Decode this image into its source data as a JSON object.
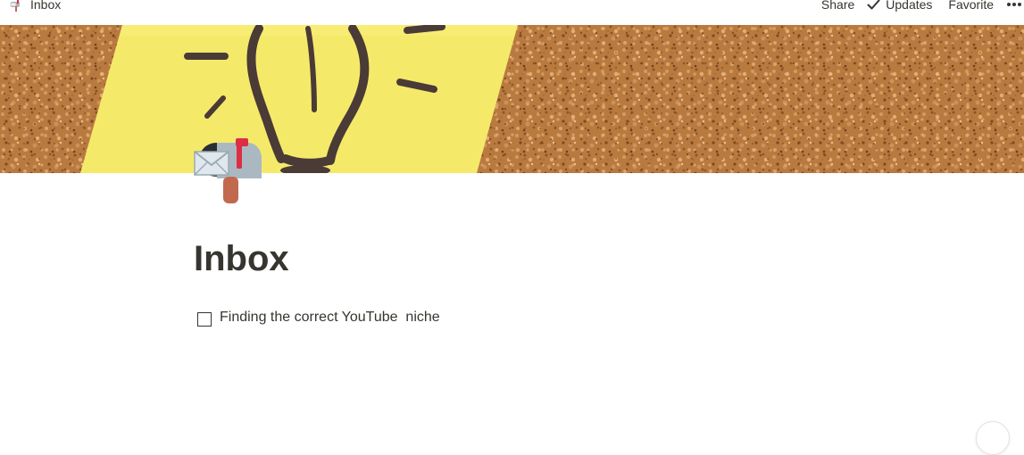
{
  "topbar": {
    "breadcrumb_title": "Inbox",
    "breadcrumb_icon": "mailbox-icon",
    "share_label": "Share",
    "updates_label": "Updates",
    "favorite_label": "Favorite",
    "more_icon": "more-horizontal-icon"
  },
  "cover": {
    "image": "lightbulb-sticky-note-on-corkboard",
    "colors": {
      "cork": "#b97a40",
      "note": "#f5e96a",
      "ink": "#4a3b36"
    }
  },
  "page": {
    "icon": "mailbox-with-letter-icon",
    "title": "Inbox",
    "todos": [
      {
        "text": "Finding the correct YouTube  niche",
        "checked": false
      }
    ]
  }
}
